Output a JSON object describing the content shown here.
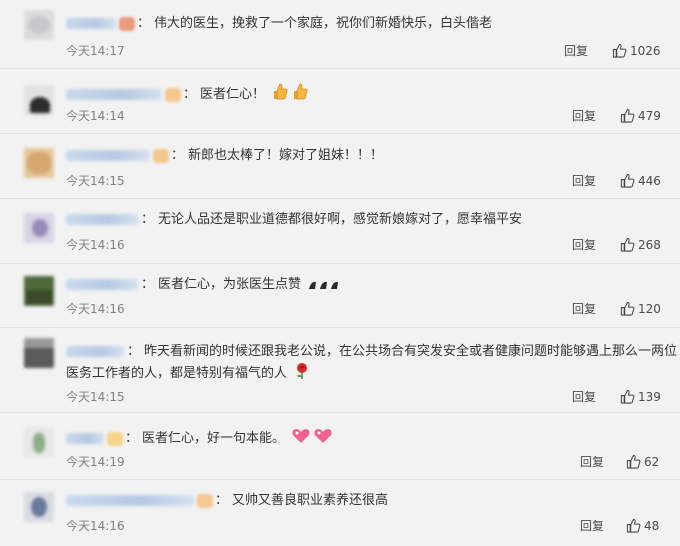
{
  "comments": [
    {
      "text": "伟大的医生，挽救了一个家庭，祝你们新婚快乐，白头偕老",
      "time": "今天14:17",
      "reply": "回复",
      "likes": "1026"
    },
    {
      "text": "医者仁心！",
      "time": "今天14:14",
      "reply": "回复",
      "likes": "479"
    },
    {
      "text": "新郎也太棒了！嫁对了姐妹！！！",
      "time": "今天14:15",
      "reply": "回复",
      "likes": "446"
    },
    {
      "text": "无论人品还是职业道德都很好啊，感觉新娘嫁对了，愿幸福平安",
      "time": "今天14:16",
      "reply": "回复",
      "likes": "268"
    },
    {
      "text": "医者仁心，为张医生点赞",
      "time": "今天14:16",
      "reply": "回复",
      "likes": "120"
    },
    {
      "text": "昨天看新闻的时候还跟我老公说，在公共场合有突发安全或者健康问题时能够遇上那么一两位",
      "text2": "医务工作者的人，都是特别有福气的人",
      "time": "今天14:15",
      "reply": "回复",
      "likes": "139"
    },
    {
      "text": "医者仁心，好一句本能。",
      "time": "今天14:19",
      "reply": "回复",
      "likes": "62"
    },
    {
      "text": "又帅又善良职业素养还很高",
      "time": "今天14:16",
      "reply": "回复",
      "likes": "48"
    }
  ],
  "icons": {
    "like": "thumbs-up-icon",
    "thumb_emoji": "thumbs-up-emoji-icon",
    "clap_emoji": "clapping-emoji-icon",
    "rose_emoji": "rose-emoji-icon",
    "heart_emoji": "heart-emoji-icon"
  }
}
